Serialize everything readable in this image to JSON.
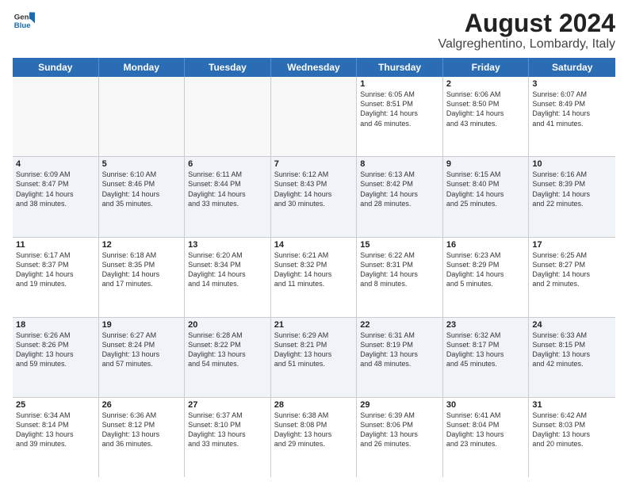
{
  "logo": {
    "line1": "General",
    "line2": "Blue"
  },
  "title": "August 2024",
  "subtitle": "Valgreghentino, Lombardy, Italy",
  "header_days": [
    "Sunday",
    "Monday",
    "Tuesday",
    "Wednesday",
    "Thursday",
    "Friday",
    "Saturday"
  ],
  "rows": [
    [
      {
        "day": "",
        "text": ""
      },
      {
        "day": "",
        "text": ""
      },
      {
        "day": "",
        "text": ""
      },
      {
        "day": "",
        "text": ""
      },
      {
        "day": "1",
        "text": "Sunrise: 6:05 AM\nSunset: 8:51 PM\nDaylight: 14 hours\nand 46 minutes."
      },
      {
        "day": "2",
        "text": "Sunrise: 6:06 AM\nSunset: 8:50 PM\nDaylight: 14 hours\nand 43 minutes."
      },
      {
        "day": "3",
        "text": "Sunrise: 6:07 AM\nSunset: 8:49 PM\nDaylight: 14 hours\nand 41 minutes."
      }
    ],
    [
      {
        "day": "4",
        "text": "Sunrise: 6:09 AM\nSunset: 8:47 PM\nDaylight: 14 hours\nand 38 minutes."
      },
      {
        "day": "5",
        "text": "Sunrise: 6:10 AM\nSunset: 8:46 PM\nDaylight: 14 hours\nand 35 minutes."
      },
      {
        "day": "6",
        "text": "Sunrise: 6:11 AM\nSunset: 8:44 PM\nDaylight: 14 hours\nand 33 minutes."
      },
      {
        "day": "7",
        "text": "Sunrise: 6:12 AM\nSunset: 8:43 PM\nDaylight: 14 hours\nand 30 minutes."
      },
      {
        "day": "8",
        "text": "Sunrise: 6:13 AM\nSunset: 8:42 PM\nDaylight: 14 hours\nand 28 minutes."
      },
      {
        "day": "9",
        "text": "Sunrise: 6:15 AM\nSunset: 8:40 PM\nDaylight: 14 hours\nand 25 minutes."
      },
      {
        "day": "10",
        "text": "Sunrise: 6:16 AM\nSunset: 8:39 PM\nDaylight: 14 hours\nand 22 minutes."
      }
    ],
    [
      {
        "day": "11",
        "text": "Sunrise: 6:17 AM\nSunset: 8:37 PM\nDaylight: 14 hours\nand 19 minutes."
      },
      {
        "day": "12",
        "text": "Sunrise: 6:18 AM\nSunset: 8:35 PM\nDaylight: 14 hours\nand 17 minutes."
      },
      {
        "day": "13",
        "text": "Sunrise: 6:20 AM\nSunset: 8:34 PM\nDaylight: 14 hours\nand 14 minutes."
      },
      {
        "day": "14",
        "text": "Sunrise: 6:21 AM\nSunset: 8:32 PM\nDaylight: 14 hours\nand 11 minutes."
      },
      {
        "day": "15",
        "text": "Sunrise: 6:22 AM\nSunset: 8:31 PM\nDaylight: 14 hours\nand 8 minutes."
      },
      {
        "day": "16",
        "text": "Sunrise: 6:23 AM\nSunset: 8:29 PM\nDaylight: 14 hours\nand 5 minutes."
      },
      {
        "day": "17",
        "text": "Sunrise: 6:25 AM\nSunset: 8:27 PM\nDaylight: 14 hours\nand 2 minutes."
      }
    ],
    [
      {
        "day": "18",
        "text": "Sunrise: 6:26 AM\nSunset: 8:26 PM\nDaylight: 13 hours\nand 59 minutes."
      },
      {
        "day": "19",
        "text": "Sunrise: 6:27 AM\nSunset: 8:24 PM\nDaylight: 13 hours\nand 57 minutes."
      },
      {
        "day": "20",
        "text": "Sunrise: 6:28 AM\nSunset: 8:22 PM\nDaylight: 13 hours\nand 54 minutes."
      },
      {
        "day": "21",
        "text": "Sunrise: 6:29 AM\nSunset: 8:21 PM\nDaylight: 13 hours\nand 51 minutes."
      },
      {
        "day": "22",
        "text": "Sunrise: 6:31 AM\nSunset: 8:19 PM\nDaylight: 13 hours\nand 48 minutes."
      },
      {
        "day": "23",
        "text": "Sunrise: 6:32 AM\nSunset: 8:17 PM\nDaylight: 13 hours\nand 45 minutes."
      },
      {
        "day": "24",
        "text": "Sunrise: 6:33 AM\nSunset: 8:15 PM\nDaylight: 13 hours\nand 42 minutes."
      }
    ],
    [
      {
        "day": "25",
        "text": "Sunrise: 6:34 AM\nSunset: 8:14 PM\nDaylight: 13 hours\nand 39 minutes."
      },
      {
        "day": "26",
        "text": "Sunrise: 6:36 AM\nSunset: 8:12 PM\nDaylight: 13 hours\nand 36 minutes."
      },
      {
        "day": "27",
        "text": "Sunrise: 6:37 AM\nSunset: 8:10 PM\nDaylight: 13 hours\nand 33 minutes."
      },
      {
        "day": "28",
        "text": "Sunrise: 6:38 AM\nSunset: 8:08 PM\nDaylight: 13 hours\nand 29 minutes."
      },
      {
        "day": "29",
        "text": "Sunrise: 6:39 AM\nSunset: 8:06 PM\nDaylight: 13 hours\nand 26 minutes."
      },
      {
        "day": "30",
        "text": "Sunrise: 6:41 AM\nSunset: 8:04 PM\nDaylight: 13 hours\nand 23 minutes."
      },
      {
        "day": "31",
        "text": "Sunrise: 6:42 AM\nSunset: 8:03 PM\nDaylight: 13 hours\nand 20 minutes."
      }
    ]
  ]
}
